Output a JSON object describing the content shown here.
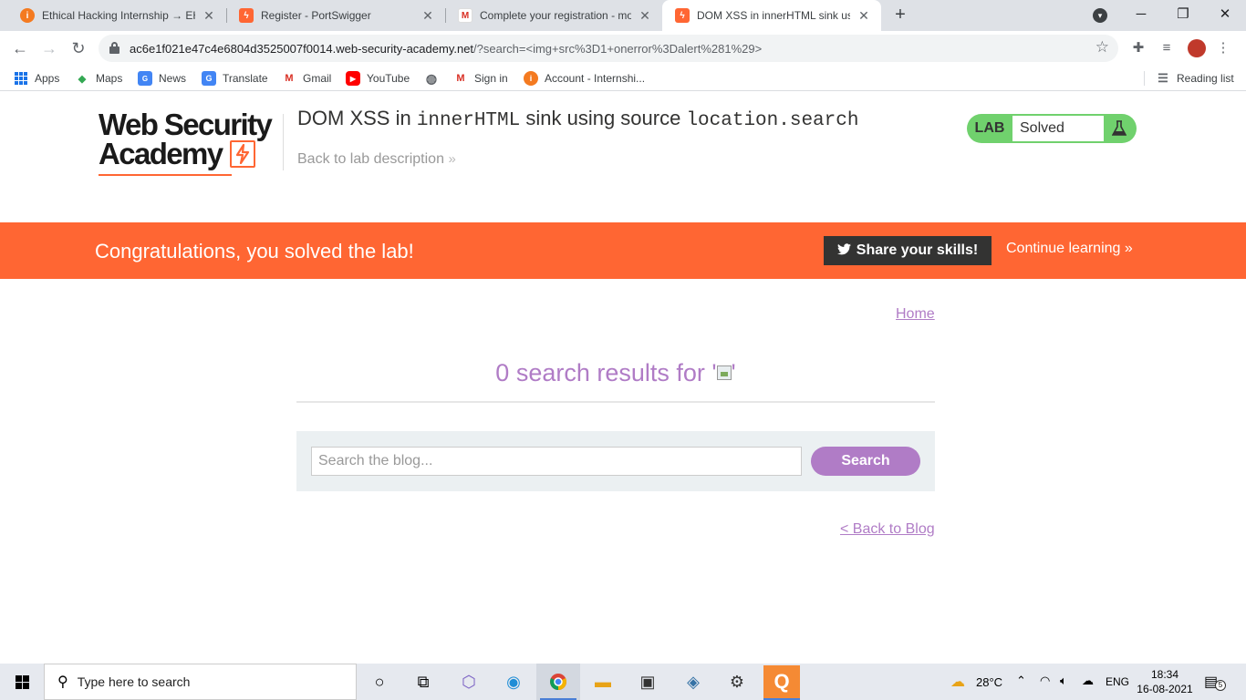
{
  "browser": {
    "tabs": [
      {
        "title": "Ethical Hacking Internship → EH C",
        "favicon": "internshala-icon",
        "active": false
      },
      {
        "title": "Register - PortSwigger",
        "favicon": "portswigger-icon",
        "active": false
      },
      {
        "title": "Complete your registration - mot",
        "favicon": "gmail-icon",
        "active": false
      },
      {
        "title": "DOM XSS in innerHTML sink usin",
        "favicon": "portswigger-icon",
        "active": true
      }
    ],
    "url_host": "ac6e1f021e47c4e6804d3525007f0014.web-security-academy.net",
    "url_path": "/?search=<img+src%3D1+onerror%3Dalert%281%29>",
    "bookmarks": [
      {
        "label": "Apps",
        "icon": "apps-grid-icon"
      },
      {
        "label": "Maps",
        "icon": "maps-icon"
      },
      {
        "label": "News",
        "icon": "news-icon"
      },
      {
        "label": "Translate",
        "icon": "translate-icon"
      },
      {
        "label": "Gmail",
        "icon": "gmail-icon"
      },
      {
        "label": "YouTube",
        "icon": "youtube-icon"
      },
      {
        "label": "",
        "icon": "globe-icon"
      },
      {
        "label": "Sign in",
        "icon": "gmail-icon"
      },
      {
        "label": "Account - Internshi...",
        "icon": "internshala-icon"
      }
    ],
    "reading_list": "Reading list"
  },
  "header": {
    "logo_line1": "Web Security",
    "logo_line2": "Academy",
    "title_prefix": "DOM XSS in ",
    "title_code1": "innerHTML",
    "title_middle": " sink using source ",
    "title_code2": "location.search",
    "back_link": "Back to lab description",
    "lab_label": "LAB",
    "lab_status": "Solved"
  },
  "banner": {
    "message": "Congratulations, you solved the lab!",
    "share_label": "Share your skills!",
    "continue_label": "Continue learning"
  },
  "main": {
    "home_link": "Home",
    "results_text": "0 search results for '",
    "results_end": "'",
    "search_placeholder": "Search the blog...",
    "search_button": "Search",
    "back_to_blog": "< Back to Blog"
  },
  "taskbar": {
    "search_placeholder": "Type here to search",
    "weather": "28°C",
    "language": "ENG",
    "time": "18:34",
    "date": "16-08-2021",
    "notification_count": "5"
  },
  "colors": {
    "accent_orange": "#ff6633",
    "link_purple": "#b07cc6",
    "lab_green": "#70d16d"
  }
}
